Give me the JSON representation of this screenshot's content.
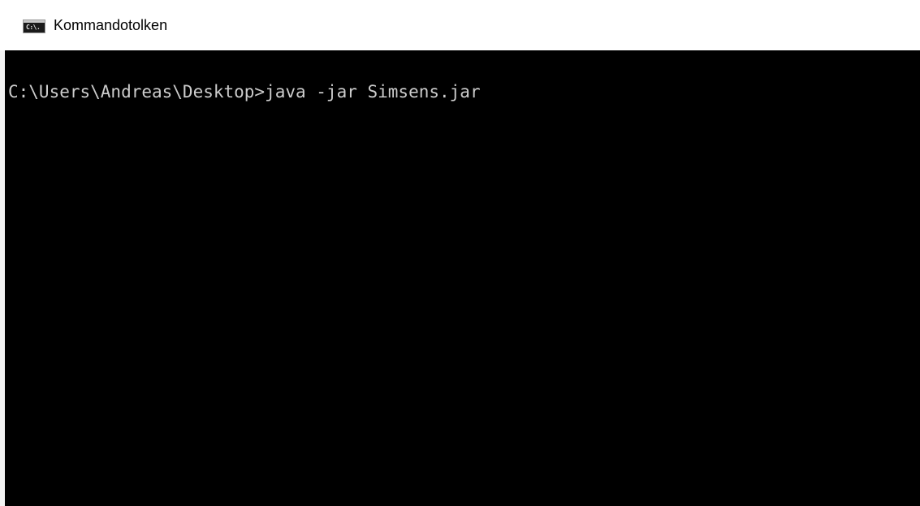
{
  "window": {
    "title": "Kommandotolken",
    "icon_name": "cmd-icon",
    "icon_text": "C:\\."
  },
  "console": {
    "lines": [
      "C:\\Users\\Andreas\\Desktop>java -jar Simsens.jar"
    ],
    "background": "#000000",
    "foreground": "#cccccc"
  }
}
